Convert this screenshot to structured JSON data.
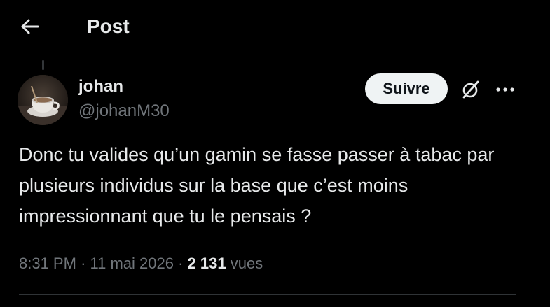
{
  "header": {
    "title": "Post",
    "back_icon": "arrow-left-icon"
  },
  "author": {
    "name": "johan",
    "handle": "@johanM30",
    "avatar": "coffee-cup-avatar"
  },
  "actions": {
    "follow_label": "Suivre",
    "grok_icon": "grok-icon",
    "more_icon": "more-dots-icon"
  },
  "post": {
    "text": "Donc tu valides qu’un gamin se fasse passer à tabac par plusieurs individus sur la base que c’est moins impressionnant que tu le pensais ?"
  },
  "meta": {
    "time": "8:31 PM",
    "separator": "·",
    "date": "11 mai 2026",
    "views_count": "2 131",
    "views_label": "vues"
  },
  "colors": {
    "background": "#000000",
    "text_primary": "#e7e9ea",
    "text_secondary": "#71767b",
    "follow_button_bg": "#eff3f4",
    "divider": "#2f3336"
  }
}
